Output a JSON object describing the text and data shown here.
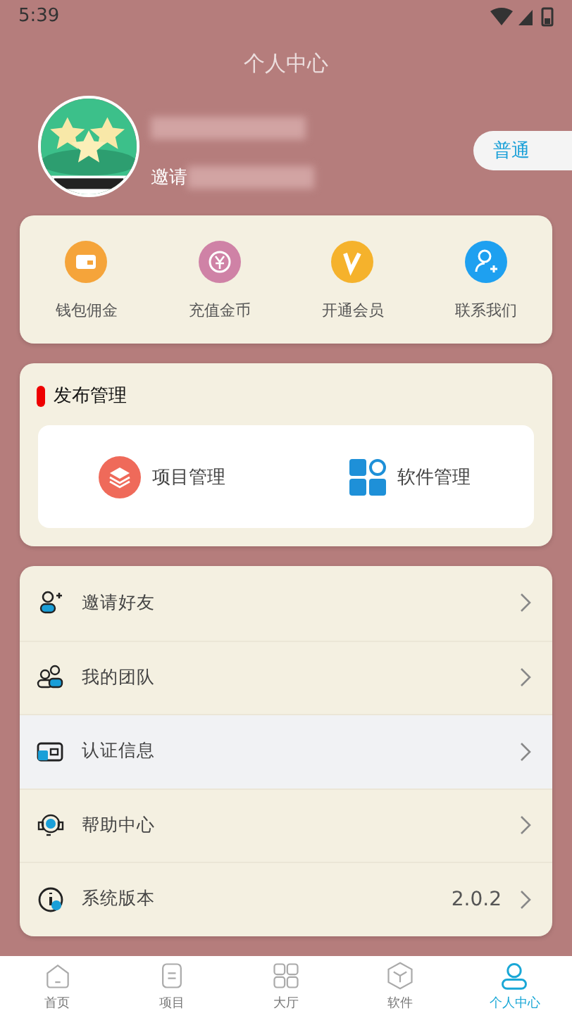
{
  "status_bar": {
    "time": "5:39"
  },
  "header": {
    "title": "个人中心",
    "invite_label": "邀请",
    "level_badge": "普通"
  },
  "quick_actions": [
    {
      "label": "钱包佣金",
      "kind": "wallet",
      "color": "#f5a43a"
    },
    {
      "label": "充值金币",
      "kind": "coin",
      "color": "#cf82a6"
    },
    {
      "label": "开通会员",
      "kind": "vip",
      "color": "#f5b22c"
    },
    {
      "label": "联系我们",
      "kind": "contact",
      "color": "#1ea0f0"
    }
  ],
  "publish": {
    "title": "发布管理",
    "items": [
      {
        "label": "项目管理",
        "kind": "project"
      },
      {
        "label": "软件管理",
        "kind": "software"
      }
    ]
  },
  "menu": [
    {
      "label": "邀请好友",
      "kind": "invite",
      "selected": false
    },
    {
      "label": "我的团队",
      "kind": "team",
      "selected": false
    },
    {
      "label": "认证信息",
      "kind": "auth",
      "selected": true
    },
    {
      "label": "帮助中心",
      "kind": "help",
      "selected": false
    },
    {
      "label": "系统版本",
      "kind": "version",
      "selected": false,
      "value": "2.0.2"
    }
  ],
  "tabs": [
    {
      "label": "首页",
      "kind": "home",
      "selected": false
    },
    {
      "label": "项目",
      "kind": "project",
      "selected": false
    },
    {
      "label": "大厅",
      "kind": "hall",
      "selected": false
    },
    {
      "label": "软件",
      "kind": "software",
      "selected": false
    },
    {
      "label": "个人中心",
      "kind": "me",
      "selected": true
    }
  ]
}
